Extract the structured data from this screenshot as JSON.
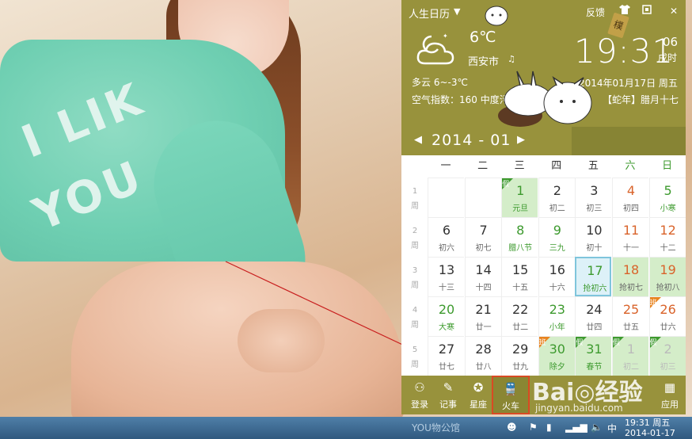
{
  "widget": {
    "app_name": "人生日历",
    "feedback": "反馈",
    "weather": {
      "temperature": "6℃",
      "city": "西安市",
      "description": "多云 6~-3℃",
      "aqi": "空气指数：160 中度污染"
    },
    "clock": {
      "time": "19:31",
      "seconds": "06",
      "period": "戌时"
    },
    "date_line": "2014年01月17日 周五",
    "lunar_line": "【蛇年】腊月十七",
    "hang_tag": "樸",
    "month_label": "2014 - 01",
    "weekdays": [
      "一",
      "二",
      "三",
      "四",
      "五",
      "六",
      "日"
    ],
    "week_suffix": "周",
    "badge_holiday": "假",
    "badge_work": "班",
    "weeks": [
      {
        "num": "1",
        "days": [
          {
            "num": "",
            "sub": ""
          },
          {
            "num": "",
            "sub": ""
          },
          {
            "num": "1",
            "sub": "元旦",
            "style": "hol",
            "badge": "jia"
          },
          {
            "num": "2",
            "sub": "初二"
          },
          {
            "num": "3",
            "sub": "初三"
          },
          {
            "num": "4",
            "sub": "初四",
            "style": "red"
          },
          {
            "num": "5",
            "sub": "小寒",
            "style": "red"
          }
        ]
      },
      {
        "num": "2",
        "days": [
          {
            "num": "6",
            "sub": "初六"
          },
          {
            "num": "7",
            "sub": "初七"
          },
          {
            "num": "8",
            "sub": "腊八节"
          },
          {
            "num": "9",
            "sub": "三九"
          },
          {
            "num": "10",
            "sub": "初十"
          },
          {
            "num": "11",
            "sub": "十一",
            "style": "red"
          },
          {
            "num": "12",
            "sub": "十二",
            "style": "red"
          }
        ]
      },
      {
        "num": "3",
        "days": [
          {
            "num": "13",
            "sub": "十三"
          },
          {
            "num": "14",
            "sub": "十四"
          },
          {
            "num": "15",
            "sub": "十五"
          },
          {
            "num": "16",
            "sub": "十六"
          },
          {
            "num": "17",
            "sub": "抢初六",
            "style": "today"
          },
          {
            "num": "18",
            "sub": "抢初七",
            "style": "hol"
          },
          {
            "num": "19",
            "sub": "抢初八",
            "style": "hol"
          }
        ]
      },
      {
        "num": "4",
        "days": [
          {
            "num": "20",
            "sub": "大寒"
          },
          {
            "num": "21",
            "sub": "廿一"
          },
          {
            "num": "22",
            "sub": "廿二"
          },
          {
            "num": "23",
            "sub": "小年"
          },
          {
            "num": "24",
            "sub": "廿四"
          },
          {
            "num": "25",
            "sub": "廿五",
            "style": "red"
          },
          {
            "num": "26",
            "sub": "廿六",
            "style": "red",
            "badge": "ban"
          }
        ]
      },
      {
        "num": "5",
        "days": [
          {
            "num": "27",
            "sub": "廿七"
          },
          {
            "num": "28",
            "sub": "廿八"
          },
          {
            "num": "29",
            "sub": "廿九"
          },
          {
            "num": "30",
            "sub": "除夕",
            "style": "hol",
            "badge": "ban"
          },
          {
            "num": "31",
            "sub": "春节",
            "style": "hol",
            "badge": "jia"
          },
          {
            "num": "1",
            "sub": "初二",
            "style": "holdim",
            "badge": "jia"
          },
          {
            "num": "2",
            "sub": "初三",
            "style": "holdim",
            "badge": "jia"
          }
        ]
      }
    ],
    "toolbar": [
      {
        "icon": "user-icon",
        "label": "登录"
      },
      {
        "icon": "note-icon",
        "label": "记事"
      },
      {
        "icon": "zodiac-icon",
        "label": "星座"
      },
      {
        "icon": "train-icon",
        "label": "火车",
        "active": true
      },
      {
        "icon": "grid-icon",
        "label": "应用"
      }
    ]
  },
  "wallpaper": {
    "shirt_text_1": "I LIK",
    "shirt_text_2": "YOU"
  },
  "watermark": {
    "brand": "Bai◎经验",
    "url": "jingyan.baidu.com"
  },
  "taskbar": {
    "task_label": "YOU物公馆",
    "ime": "中",
    "time": "19:31 周五",
    "date": "2014-01-17"
  },
  "colors": {
    "widget_bg": "#98923c",
    "holiday_green": "#3d9a2e",
    "weekend_red": "#d9632a",
    "today_blue": "#7fc5dc",
    "train_highlight": "#d94a23"
  }
}
